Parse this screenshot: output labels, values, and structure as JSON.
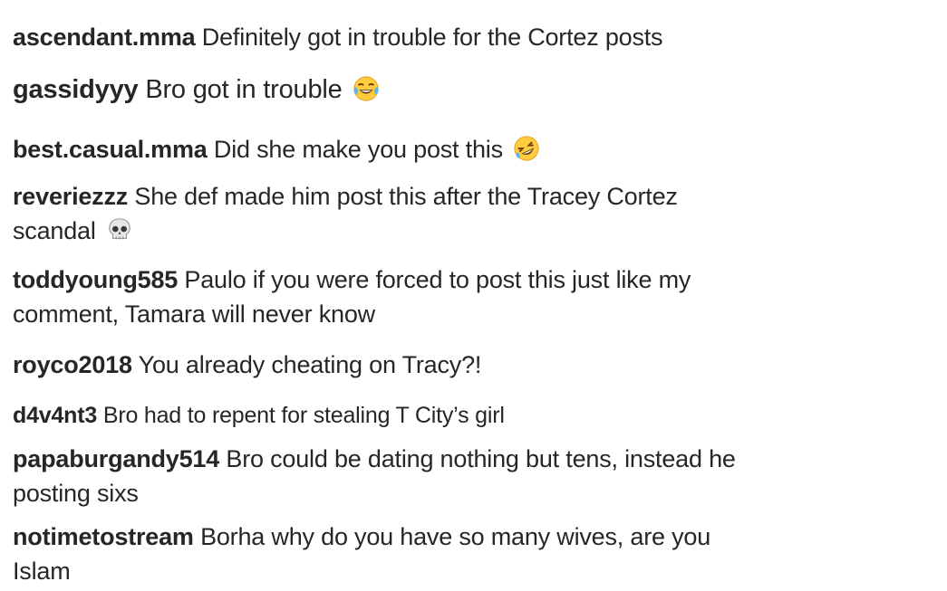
{
  "comments": [
    {
      "user": "ascendant.mma",
      "text": "Definitely got in trouble for the Cortez posts",
      "emoji": ""
    },
    {
      "user": "gassidyyy",
      "text": "Bro got in trouble",
      "emoji": "tears-of-joy-icon"
    },
    {
      "user": "best.casual.mma",
      "text": "Did she make you post this",
      "emoji": "rolling-laughing-icon"
    },
    {
      "user": "reveriezzz",
      "text": "She def made him post this after the Tracey Cortez scandal",
      "emoji": "skull-icon"
    },
    {
      "user": "toddyoung585",
      "text": "Paulo if you were forced to post this just like my comment, Tamara will never know",
      "emoji": ""
    },
    {
      "user": "royco2018",
      "text": "You already cheating on Tracy?!",
      "emoji": ""
    },
    {
      "user": "d4v4nt3",
      "text": "Bro had to repent for stealing T City’s girl",
      "emoji": ""
    },
    {
      "user": "papaburgandy514",
      "text": "Bro could be dating nothing but tens, instead he posting sixs",
      "emoji": ""
    },
    {
      "user": "notimetostream",
      "text": "Borha why do you have so many wives, are you Islam",
      "emoji": ""
    }
  ]
}
